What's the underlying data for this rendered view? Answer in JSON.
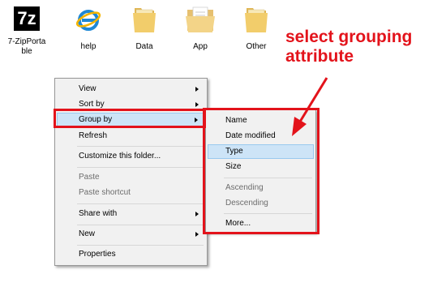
{
  "desktop": {
    "icons": [
      {
        "label": "7-ZipPortable",
        "icon": "7zip-icon"
      },
      {
        "label": "help",
        "icon": "internet-explorer-icon"
      },
      {
        "label": "Data",
        "icon": "folder-icon"
      },
      {
        "label": "App",
        "icon": "folder-document-icon"
      },
      {
        "label": "Other",
        "icon": "folder-icon"
      }
    ],
    "seven_zip_glyph": "7z"
  },
  "context_menu": {
    "items": [
      {
        "label": "View",
        "submenu": true
      },
      {
        "label": "Sort by",
        "submenu": true
      },
      {
        "label": "Group by",
        "submenu": true,
        "highlighted": true
      },
      {
        "label": "Refresh"
      },
      {
        "label": "Customize this folder..."
      },
      {
        "label": "Paste",
        "disabled": true
      },
      {
        "label": "Paste shortcut",
        "disabled": true
      },
      {
        "label": "Share with",
        "submenu": true
      },
      {
        "label": "New",
        "submenu": true
      },
      {
        "label": "Properties"
      }
    ]
  },
  "group_by_submenu": {
    "items": [
      {
        "label": "Name"
      },
      {
        "label": "Date modified"
      },
      {
        "label": "Type",
        "highlighted": true
      },
      {
        "label": "Size"
      },
      {
        "label": "Ascending",
        "disabled": true
      },
      {
        "label": "Descending",
        "disabled": true
      },
      {
        "label": "More..."
      }
    ]
  },
  "annotation": {
    "line1": "select grouping",
    "line2": "attribute",
    "color": "#e3131b"
  }
}
